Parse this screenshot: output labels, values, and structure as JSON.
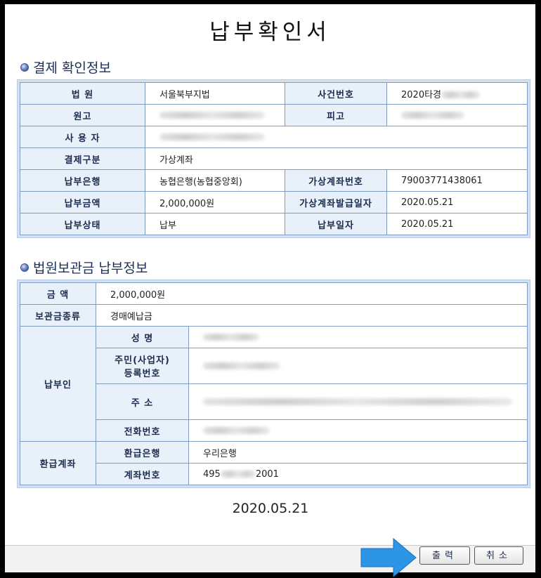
{
  "title": "납부확인서",
  "payment_section": {
    "heading": "결제 확인정보",
    "court_label": "법 원",
    "court_value": "서울북부지법",
    "case_no_label": "사건번호",
    "case_no_value": "2020타경",
    "plaintiff_label": "원고",
    "defendant_label": "피고",
    "user_label": "사 용 자",
    "payment_type_label": "결제구분",
    "payment_type_value": "가상계좌",
    "bank_label": "납부은행",
    "bank_value": "농협은행(농협중앙회)",
    "virtual_account_label": "가상계좌번호",
    "virtual_account_value": "79003771438061",
    "amount_label": "납부금액",
    "amount_value": "2,000,000원",
    "issue_date_label": "가상계좌발급일자",
    "issue_date_value": "2020.05.21",
    "status_label": "납부상태",
    "status_value": "납부",
    "pay_date_label": "납부일자",
    "pay_date_value": "2020.05.21"
  },
  "deposit_section": {
    "heading": "법원보관금 납부정보",
    "amount_label": "금 액",
    "amount_value": "2,000,000원",
    "type_label": "보관금종류",
    "type_value": "경매예납금",
    "payer_label": "납부인",
    "name_label": "성 명",
    "id_label_line1": "주민(사업자)",
    "id_label_line2": "등록번호",
    "address_label": "주 소",
    "phone_label": "전화번호",
    "refund_label": "환급계좌",
    "refund_bank_label": "환급은행",
    "refund_bank_value": "우리은행",
    "refund_account_label": "계좌번호",
    "refund_account_prefix": "495",
    "refund_account_suffix": "2001"
  },
  "footer": {
    "date": "2020.05.21",
    "print_label": "출력",
    "cancel_label": "취소"
  },
  "colors": {
    "header_cell_bg": "#e8f0fa",
    "frame_bg": "#d3e1f0",
    "arrow": "#2d95e6"
  }
}
